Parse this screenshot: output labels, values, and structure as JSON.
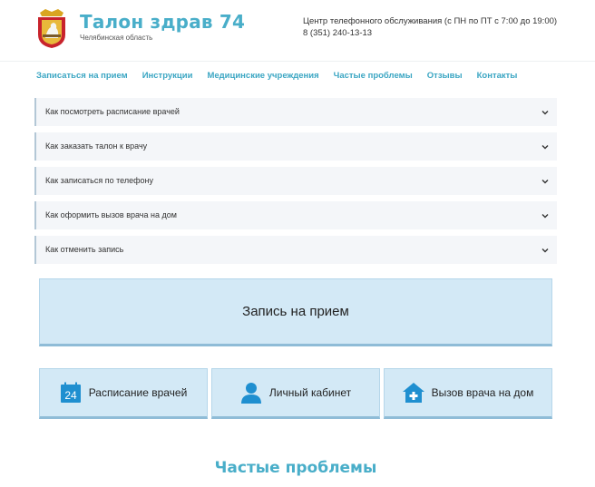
{
  "header": {
    "title": "Талон здрав 74",
    "region": "Челябинская область",
    "phone_label": "Центр телефонного обслуживания (с ПН по ПТ с 7:00 до 19:00)",
    "phone_number": "8 (351) 240-13-13"
  },
  "nav": {
    "items": [
      {
        "label": "Записаться на прием"
      },
      {
        "label": "Инструкции"
      },
      {
        "label": "Медицинские учреждения"
      },
      {
        "label": "Частые проблемы"
      },
      {
        "label": "Отзывы"
      },
      {
        "label": "Контакты"
      }
    ]
  },
  "faq": {
    "items": [
      {
        "question": "Как посмотреть расписание врачей"
      },
      {
        "question": "Как заказать талон к врачу"
      },
      {
        "question": "Как записаться по телефону"
      },
      {
        "question": "Как оформить вызов врача на дом"
      },
      {
        "question": "Как отменить запись"
      }
    ]
  },
  "actions": {
    "main_label": "Запись на прием",
    "tiles": [
      {
        "label": "Расписание врачей",
        "icon": "calendar-icon",
        "icon_text": "24"
      },
      {
        "label": "Личный кабинет",
        "icon": "user-icon"
      },
      {
        "label": "Вызов врача на дом",
        "icon": "house-medical-icon"
      }
    ]
  },
  "section": {
    "title": "Частые проблемы"
  },
  "colors": {
    "brand": "#49aec9",
    "nav_link": "#3ba6c3",
    "tile_bg": "#d3e9f6",
    "icon_blue": "#1f8fd0"
  }
}
